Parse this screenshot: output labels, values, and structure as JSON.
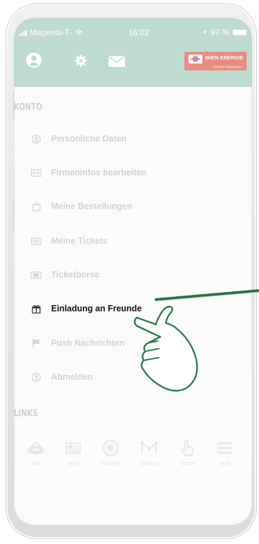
{
  "status": {
    "carrier": "Magenta-T-",
    "time": "16:02",
    "battery": "97 %"
  },
  "header": {
    "icons": [
      "user-icon",
      "gear-icon",
      "mail-icon"
    ],
    "logo_brand": "WIEN ENERGIE",
    "logo_sub": "Offizieller Hauptsponsor"
  },
  "konto_label": "KONTO",
  "menu": [
    {
      "label": "Persönliche Daten",
      "icon": "user-icon"
    },
    {
      "label": "Firmeninfos bearbeiten",
      "icon": "id-card-icon"
    },
    {
      "label": "Meine Bestellungen",
      "icon": "cart-icon"
    },
    {
      "label": "Meine Tickets",
      "icon": "ticket-icon"
    },
    {
      "label": "Ticketbörse",
      "icon": "ticket-exchange-icon"
    },
    {
      "label": "Einladung an Freunde",
      "icon": "gift-icon"
    },
    {
      "label": "Push Nachrichten",
      "icon": "flag-icon"
    },
    {
      "label": "Abmelden",
      "icon": "logout-icon"
    }
  ],
  "active_item": "Einladung an Freunde",
  "links_label": "LINKS",
  "tabs": [
    {
      "label": "HOME",
      "icon": "stadium-icon"
    },
    {
      "label": "NEWS",
      "icon": "newspaper-icon"
    },
    {
      "label": "MATCHES",
      "icon": "ball-icon"
    },
    {
      "label": "BUSINESS",
      "icon": "network-icon"
    },
    {
      "label": "ACTION",
      "icon": "hand-icon"
    },
    {
      "label": "MEHR",
      "icon": "menu-icon"
    }
  ],
  "colors": {
    "header": "#bfdbd0",
    "logo": "#ea8d80",
    "accent": "#2e7d4f",
    "inactive": "#d3d3d3"
  }
}
